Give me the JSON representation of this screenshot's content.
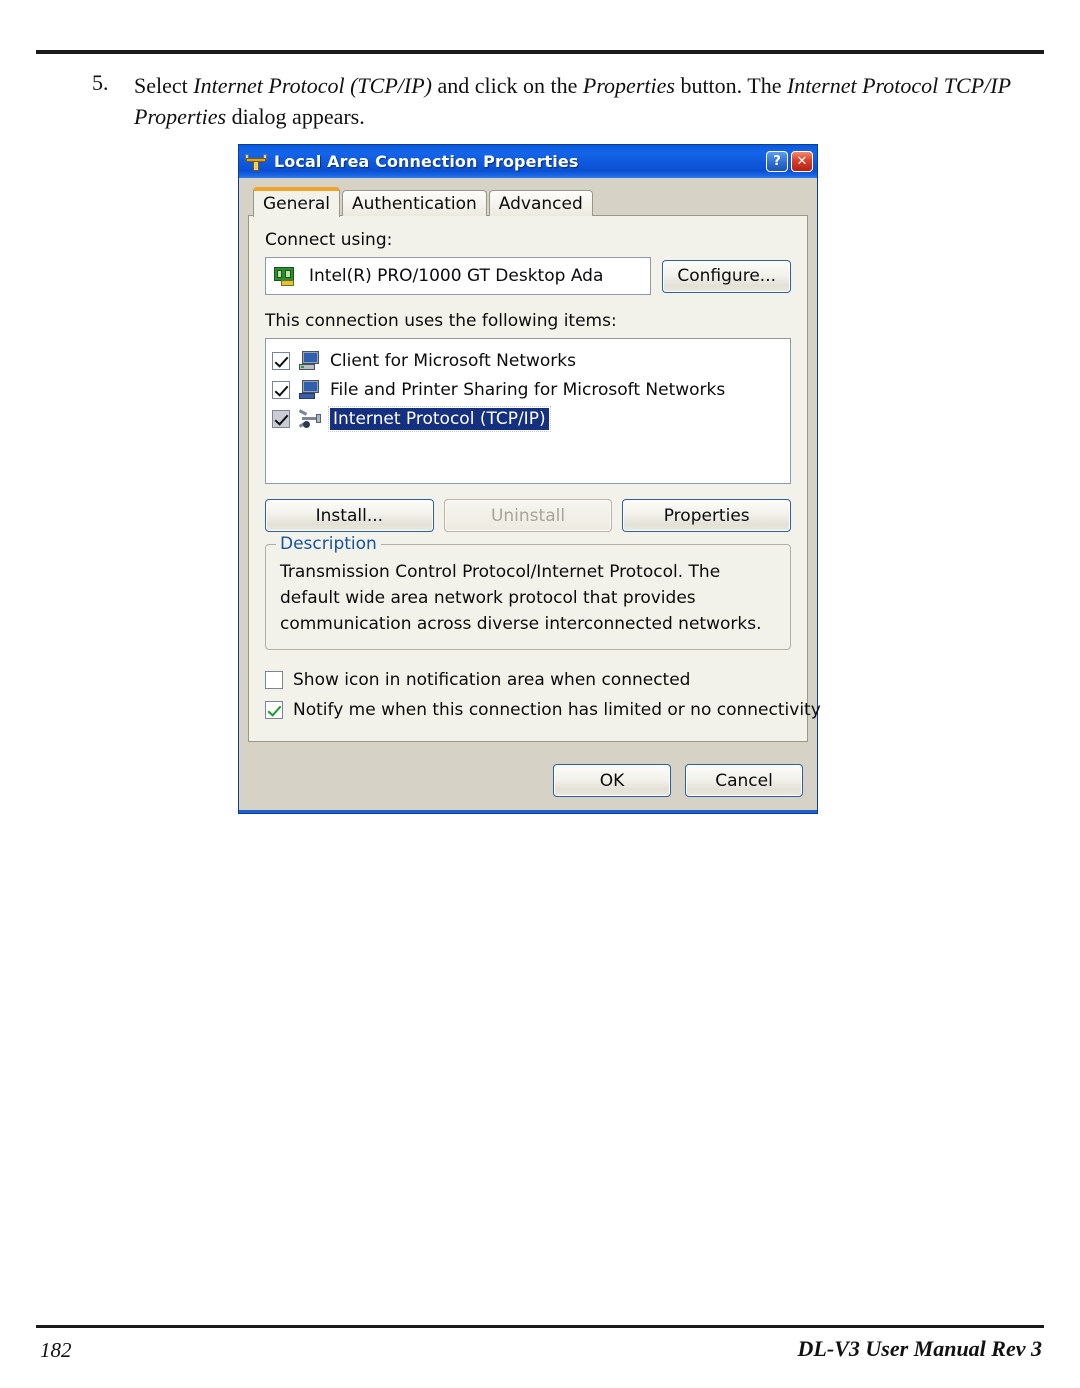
{
  "page": {
    "footer_page_number": "182",
    "footer_manual": "DL-V3 User Manual Rev 3"
  },
  "step": {
    "number": "5.",
    "text_segments": [
      {
        "text": "Select ",
        "italic": false
      },
      {
        "text": "Internet Protocol (TCP/IP)",
        "italic": true
      },
      {
        "text": " and click on the ",
        "italic": false
      },
      {
        "text": "Properties",
        "italic": true
      },
      {
        "text": " button. The ",
        "italic": false
      },
      {
        "text": "Internet Protocol TCP/IP Properties",
        "italic": true
      },
      {
        "text": " dialog appears.",
        "italic": false
      }
    ],
    "part1_plain": "Select ",
    "part2_italic": "Internet Protocol (TCP/IP)",
    "part3_plain": " and click on the ",
    "part4_italic": "Properties",
    "part5_plain": " button. The ",
    "part6_italic": "Internet Protocol TCP/IP Properties",
    "part7_plain": " dialog appears."
  },
  "dialog": {
    "title": "Local Area Connection Properties",
    "title_icon": "network-connection-icon",
    "help_button_label": "?",
    "close_button_label": "✕",
    "tabs": [
      {
        "label": "General",
        "active": true
      },
      {
        "label": "Authentication",
        "active": false
      },
      {
        "label": "Advanced",
        "active": false
      }
    ],
    "connect_using": {
      "label": "Connect using:",
      "adapter_icon": "network-adapter-icon",
      "adapter_name": "Intel(R) PRO/1000 GT Desktop Ada",
      "configure_button": "Configure..."
    },
    "items_section": {
      "label": "This connection uses the following items:",
      "items": [
        {
          "label": "Client for Microsoft Networks",
          "checked": true,
          "selected": false,
          "icon": "computer-client-icon"
        },
        {
          "label": "File and Printer Sharing for Microsoft Networks",
          "checked": true,
          "selected": false,
          "icon": "computer-sharing-icon"
        },
        {
          "label": "Internet Protocol (TCP/IP)",
          "checked": true,
          "selected": true,
          "icon": "network-protocol-icon"
        }
      ]
    },
    "action_buttons": [
      {
        "label": "Install...",
        "enabled": true
      },
      {
        "label": "Uninstall",
        "enabled": false
      },
      {
        "label": "Properties",
        "enabled": true
      }
    ],
    "description": {
      "legend": "Description",
      "text": "Transmission Control Protocol/Internet Protocol. The default wide area network protocol that provides communication across diverse interconnected networks."
    },
    "options": [
      {
        "label": "Show icon in notification area when connected",
        "checked": false
      },
      {
        "label": "Notify me when this connection has limited or no connectivity",
        "checked": true
      }
    ],
    "footer_buttons": [
      {
        "label": "OK"
      },
      {
        "label": "Cancel"
      }
    ]
  },
  "colors": {
    "titlebar_blue": "#0d5ee0",
    "dialog_face": "#d6d2c6",
    "tab_panel": "#f2f1ea",
    "selection_navy": "#14307e",
    "legend_blue": "#15539e",
    "active_tab_orange": "#f0a22b",
    "close_red": "#d9402a",
    "check_green": "#179c28"
  }
}
